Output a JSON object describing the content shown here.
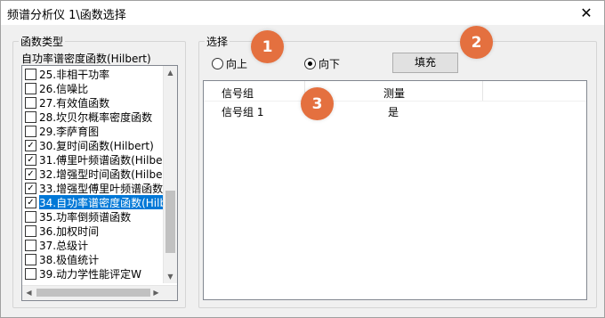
{
  "window": {
    "title": "频谱分析仪 1\\函数选择",
    "close_glyph": "✕"
  },
  "function_type": {
    "group_title": "函数类型",
    "selected_text": "自功率谱密度函数(Hilbert)",
    "items": [
      {
        "label": "25.非相干功率",
        "checked": false,
        "selected": false
      },
      {
        "label": "26.信噪比",
        "checked": false,
        "selected": false
      },
      {
        "label": "27.有效值函数",
        "checked": false,
        "selected": false
      },
      {
        "label": "28.坎贝尔概率密度函数",
        "checked": false,
        "selected": false
      },
      {
        "label": "29.李萨育图",
        "checked": false,
        "selected": false
      },
      {
        "label": "30.复时间函数(Hilbert)",
        "checked": true,
        "selected": false
      },
      {
        "label": "31.傅里叶频谱函数(Hilbert",
        "checked": true,
        "selected": false
      },
      {
        "label": "32.增强型时间函数(Hilbert)",
        "checked": true,
        "selected": false
      },
      {
        "label": "33.增强型傅里叶频谱函数(",
        "checked": true,
        "selected": false
      },
      {
        "label": "34.自功率谱密度函数(Hilbe",
        "checked": true,
        "selected": true
      },
      {
        "label": "35.功率倒频谱函数",
        "checked": false,
        "selected": false
      },
      {
        "label": "36.加权时间",
        "checked": false,
        "selected": false
      },
      {
        "label": "37.总级计",
        "checked": false,
        "selected": false
      },
      {
        "label": "38.极值统计",
        "checked": false,
        "selected": false
      },
      {
        "label": "39.动力学性能评定W",
        "checked": false,
        "selected": false
      }
    ]
  },
  "selection": {
    "group_title": "选择",
    "radio_up": "向上",
    "radio_down": "向下",
    "radio_checked": "down",
    "fill_button": "填充",
    "grid": {
      "headers": [
        "信号组",
        "测量"
      ],
      "rows": [
        [
          "信号组 1",
          "是"
        ]
      ]
    }
  },
  "badges": [
    "1",
    "2",
    "3"
  ],
  "colors": {
    "badge": "#e4703f",
    "selection": "#0078d7"
  }
}
